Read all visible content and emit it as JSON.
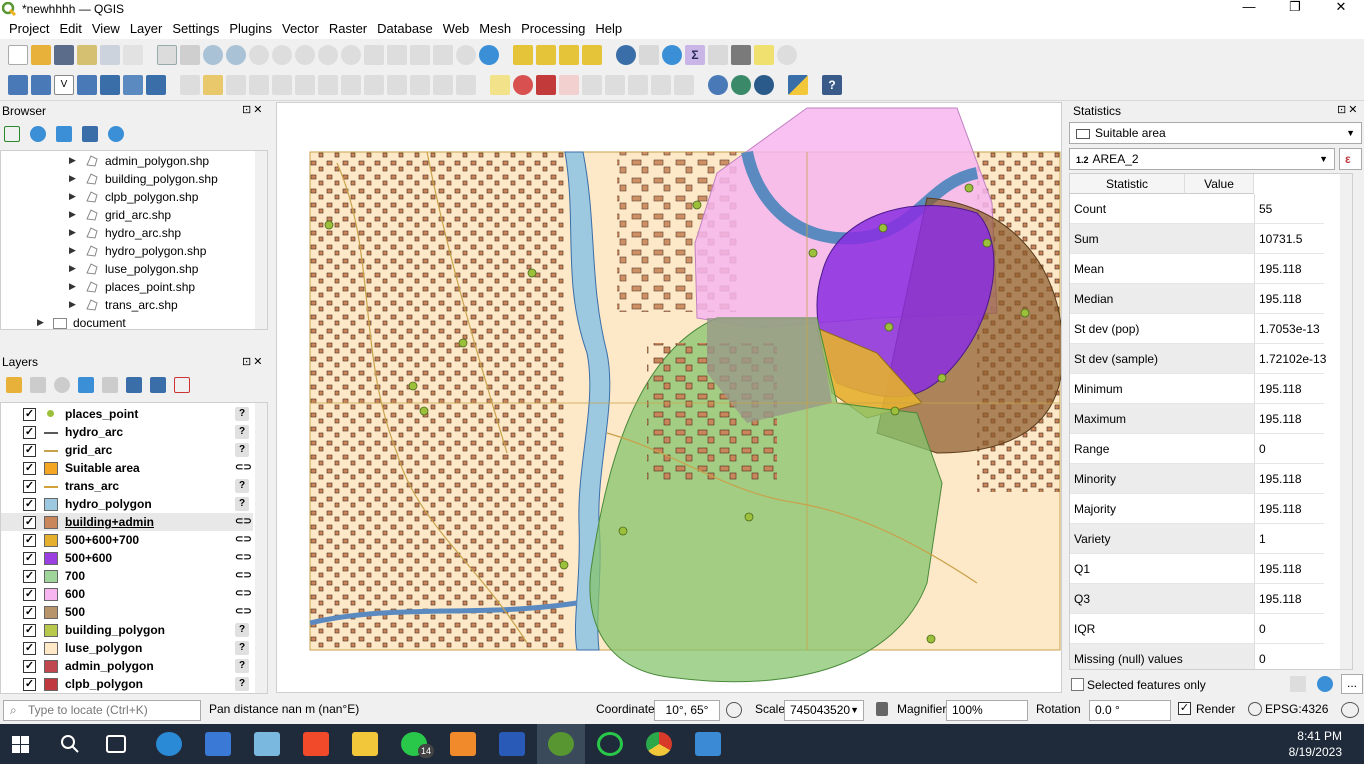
{
  "window": {
    "title": "*newhhhh — QGIS",
    "minimize": "—",
    "maximize": "❐",
    "close": "✕"
  },
  "menu": [
    "Project",
    "Edit",
    "View",
    "Layer",
    "Settings",
    "Plugins",
    "Vector",
    "Raster",
    "Database",
    "Web",
    "Mesh",
    "Processing",
    "Help"
  ],
  "browser": {
    "title": "Browser",
    "items": [
      "admin_polygon.shp",
      "building_polygon.shp",
      "clpb_polygon.shp",
      "grid_arc.shp",
      "hydro_arc.shp",
      "hydro_polygon.shp",
      "luse_polygon.shp",
      "places_point.shp",
      "trans_arc.shp"
    ],
    "folder": "document"
  },
  "layers": {
    "title": "Layers",
    "items": [
      {
        "name": "places_point",
        "symbol": "point",
        "color": "#9cc03b",
        "checked": "✓",
        "status": "?"
      },
      {
        "name": "hydro_arc",
        "symbol": "line",
        "color": "#5a5a5a",
        "checked": "✓",
        "status": "?"
      },
      {
        "name": "grid_arc",
        "symbol": "line",
        "color": "#c8a24a",
        "checked": "✓",
        "status": "?"
      },
      {
        "name": "Suitable area",
        "symbol": "fill",
        "color": "#f5a623",
        "checked": "✓",
        "status": "⊂⊃"
      },
      {
        "name": "trans_arc",
        "symbol": "line",
        "color": "#d4a03a",
        "checked": "✓",
        "status": "?"
      },
      {
        "name": "hydro_polygon",
        "symbol": "fill",
        "color": "#9cc8e0",
        "checked": "✓",
        "status": "?"
      },
      {
        "name": "building+admin",
        "symbol": "fill",
        "color": "#c8865a",
        "checked": "✓",
        "status": "⊂⊃"
      },
      {
        "name": "500+600+700",
        "symbol": "fill",
        "color": "#e6b02f",
        "checked": "✓",
        "status": "⊂⊃"
      },
      {
        "name": "500+600",
        "symbol": "fill",
        "color": "#9b3fe0",
        "checked": "✓",
        "status": "⊂⊃"
      },
      {
        "name": "700",
        "symbol": "fill",
        "color": "#9fd49a",
        "checked": "✓",
        "status": "⊂⊃"
      },
      {
        "name": "600",
        "symbol": "fill",
        "color": "#f7b6f0",
        "checked": "✓",
        "status": "⊂⊃"
      },
      {
        "name": "500",
        "symbol": "fill",
        "color": "#b8946a",
        "checked": "✓",
        "status": "⊂⊃"
      },
      {
        "name": "building_polygon",
        "symbol": "fill",
        "color": "#b7c84a",
        "checked": "✓",
        "status": "?"
      },
      {
        "name": "luse_polygon",
        "symbol": "fill",
        "color": "#fde8c8",
        "checked": "✓",
        "status": "?"
      },
      {
        "name": "admin_polygon",
        "symbol": "fill",
        "color": "#c0474f",
        "checked": "✓",
        "status": "?"
      },
      {
        "name": "clpb_polygon",
        "symbol": "fill",
        "color": "#c0393f",
        "checked": "✓",
        "status": "?"
      }
    ]
  },
  "statistics": {
    "title": "Statistics",
    "layer": "Suitable area",
    "field_type": "1.2",
    "field": "AREA_2",
    "headers": [
      "Statistic",
      "Value"
    ],
    "rows": [
      [
        "Count",
        "55"
      ],
      [
        "Sum",
        "10731.5"
      ],
      [
        "Mean",
        "195.118"
      ],
      [
        "Median",
        "195.118"
      ],
      [
        "St dev (pop)",
        "1.7053e-13"
      ],
      [
        "St dev (sample)",
        "1.72102e-13"
      ],
      [
        "Minimum",
        "195.118"
      ],
      [
        "Maximum",
        "195.118"
      ],
      [
        "Range",
        "0"
      ],
      [
        "Minority",
        "195.118"
      ],
      [
        "Majority",
        "195.118"
      ],
      [
        "Variety",
        "1"
      ],
      [
        "Q1",
        "195.118"
      ],
      [
        "Q3",
        "195.118"
      ],
      [
        "IQR",
        "0"
      ],
      [
        "Missing (null) values",
        "0"
      ]
    ],
    "selected_only": "Selected features only",
    "expression_btn": "ε",
    "more_btn": "..."
  },
  "statusbar": {
    "locate_placeholder": "Type to locate (Ctrl+K)",
    "message": "Pan distance nan m (nan°E)",
    "coordinate_label": "Coordinate",
    "coordinate": "10°, 65°",
    "scale_label": "Scale",
    "scale": "745043520",
    "magnifier_label": "Magnifier",
    "magnifier": "100%",
    "rotation_label": "Rotation",
    "rotation": "0.0 °",
    "render_label": "Render",
    "crs": "EPSG:4326"
  },
  "taskbar": {
    "time": "8:41 PM",
    "date": "8/19/2023",
    "whatsapp_badge": "14"
  }
}
